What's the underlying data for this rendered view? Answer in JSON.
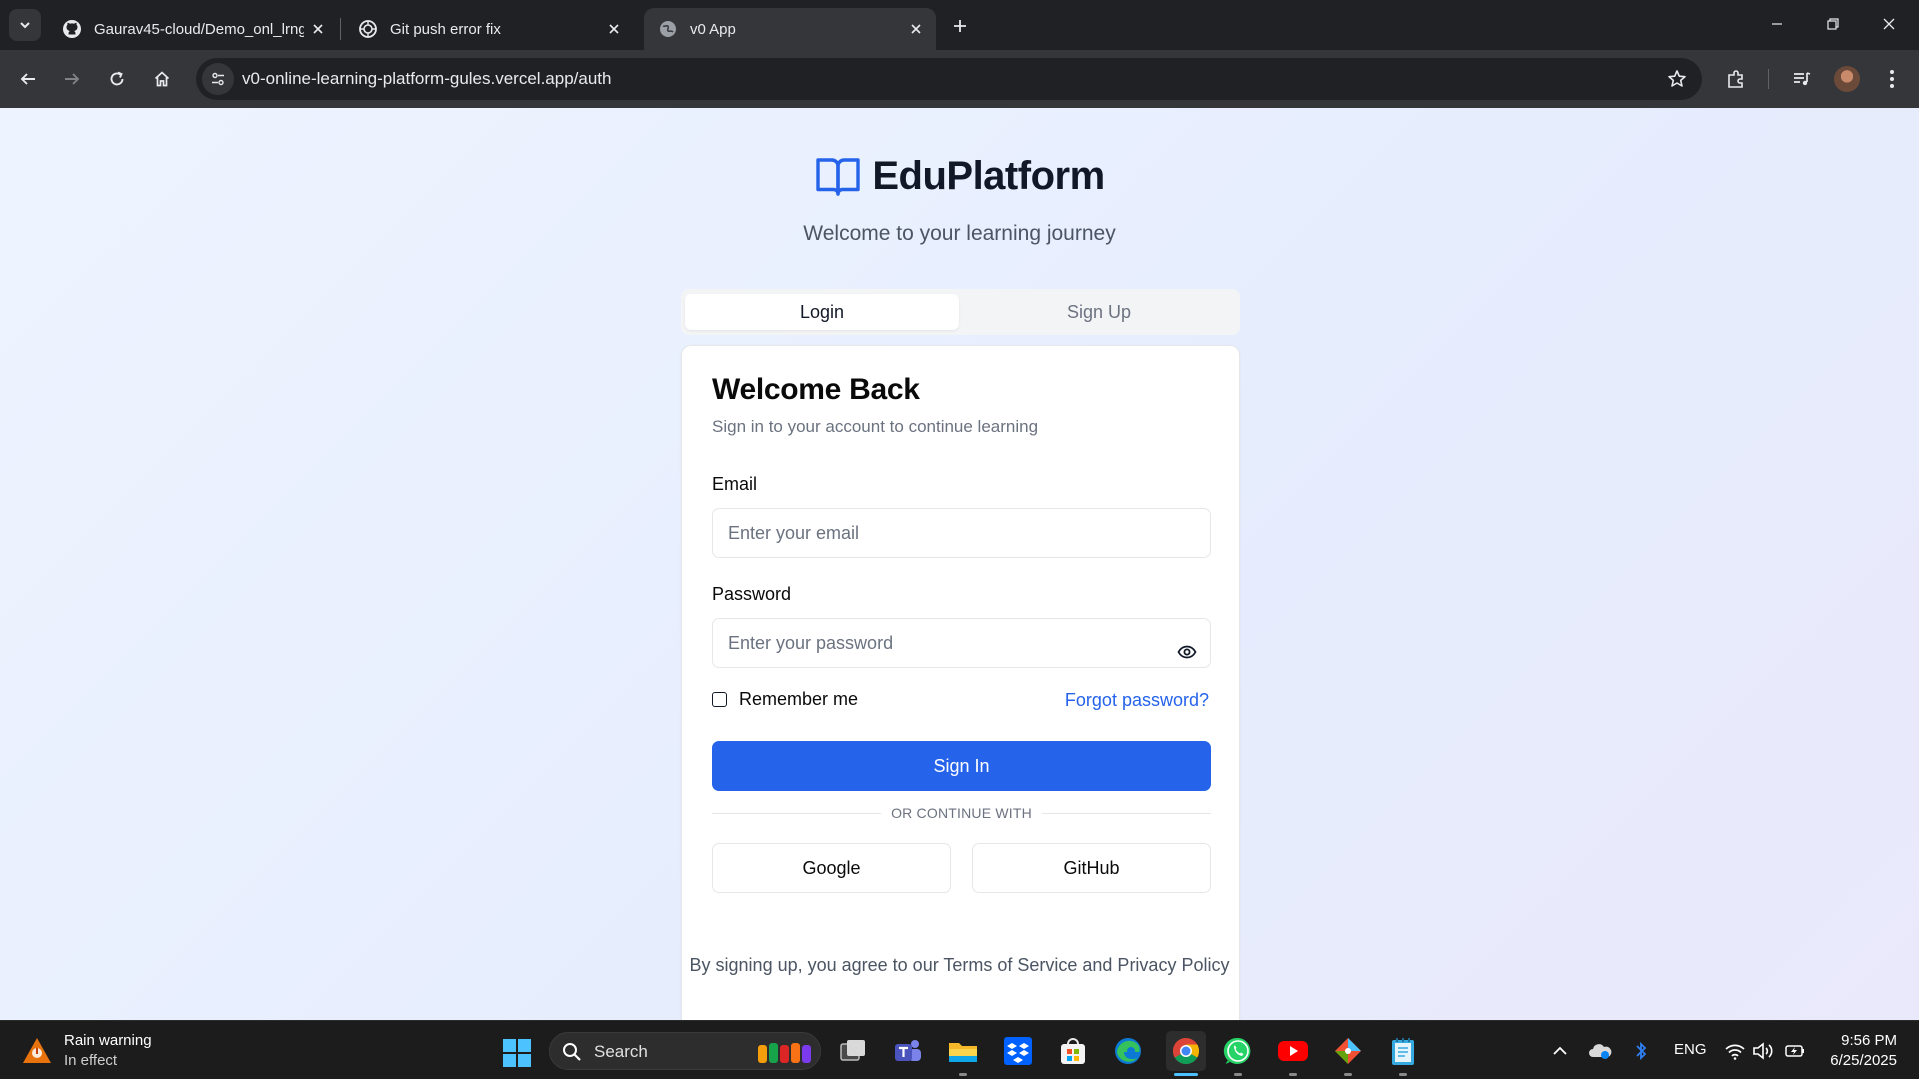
{
  "browser": {
    "tabs": [
      {
        "title": "Gaurav45-cloud/Demo_onl_lrng",
        "favicon": "github-icon",
        "active": false
      },
      {
        "title": "Git push error fix",
        "favicon": "openai-icon",
        "active": false
      },
      {
        "title": "v0 App",
        "favicon": "globe-icon",
        "active": true
      }
    ],
    "url": "v0-online-learning-platform-gules.vercel.app/auth"
  },
  "page": {
    "brand_name": "EduPlatform",
    "tagline": "Welcome to your learning journey",
    "auth_tabs": {
      "login": "Login",
      "signup": "Sign Up",
      "active": "login"
    },
    "card": {
      "title": "Welcome Back",
      "subtitle": "Sign in to your account to continue learning",
      "email_label": "Email",
      "email_placeholder": "Enter your email",
      "password_label": "Password",
      "password_placeholder": "Enter your password",
      "remember_label": "Remember me",
      "remember_checked": false,
      "forgot_label": "Forgot password?",
      "signin_label": "Sign In",
      "divider_text": "OR CONTINUE WITH",
      "google_label": "Google",
      "github_label": "GitHub"
    },
    "legal_text": "By signing up, you agree to our Terms of Service and Privacy Policy"
  },
  "taskbar": {
    "weather_title": "Rain warning",
    "weather_subtitle": "In effect",
    "search_label": "Search",
    "apps": [
      "task-view-icon",
      "teams-icon",
      "file-explorer-icon",
      "dropbox-icon",
      "microsoft-store-icon",
      "edge-icon",
      "chrome-icon",
      "whatsapp-icon",
      "youtube-icon",
      "git-icon",
      "notepad-icon"
    ],
    "language": "ENG",
    "time": "9:56 PM",
    "date": "6/25/2025"
  },
  "colors": {
    "primary": "#2563eb",
    "page_bg_start": "#eef4ff",
    "page_bg_end": "#e9e9fb",
    "text_dark": "#0a0a0a",
    "text_muted": "#6b7280"
  }
}
